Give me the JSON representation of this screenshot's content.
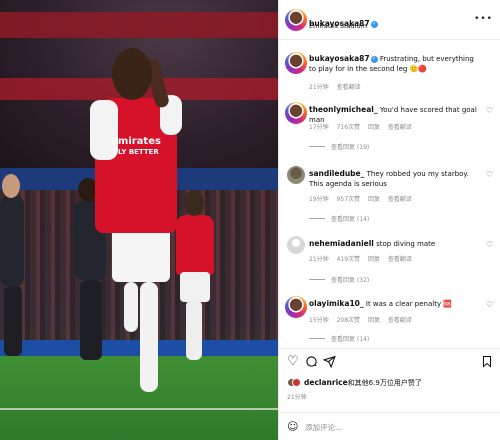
{
  "post": {
    "username": "bukayosaka87",
    "location": "Emirates Stadium",
    "more_icon": "more-horizontal-icon"
  },
  "photo": {
    "shirt_text_line1": "Emirates",
    "shirt_text_line2": "FLY BETTER"
  },
  "caption": {
    "username": "bukayosaka87",
    "text": "Frustrating, but everything to play for in the second leg 🙂🔴",
    "time": "21分钟",
    "translate": "查看翻译"
  },
  "comments": [
    {
      "username": "theonlymicheal_",
      "text": "You'd have scored that goal man",
      "time": "17分钟",
      "likes": "716次赞",
      "reply": "回复",
      "translate": "查看翻译",
      "view_replies": "查看回复 (19)"
    },
    {
      "username": "sandiledube_",
      "text": "They robbed you my starboy. This agenda is serious",
      "time": "19分钟",
      "likes": "957次赞",
      "reply": "回复",
      "translate": "查看翻译",
      "view_replies": "查看回复 (14)"
    },
    {
      "username": "nehemiadaniell",
      "text": "stop diving mate",
      "time": "21分钟",
      "likes": "419次赞",
      "reply": "回复",
      "translate": "查看翻译",
      "view_replies": "查看回复 (32)"
    },
    {
      "username": "olayimika10_",
      "text": "It was a clear penalty 🆘",
      "time": "15分钟",
      "likes": "208次赞",
      "reply": "回复",
      "translate": "查看翻译",
      "view_replies": "查看回复 (14)"
    }
  ],
  "likes_line": {
    "user": "declanrice",
    "rest": "和其他6.9万位用户赞了"
  },
  "post_time": "21分钟",
  "add_comment": {
    "placeholder": "添加评论..."
  },
  "icons": {
    "like": "heart-icon",
    "comment": "comment-icon",
    "share": "share-icon",
    "save": "bookmark-icon",
    "emoji": "smiley-icon"
  },
  "colors": {
    "verified": "#2f9bf0",
    "arsenal_red": "#d5122a"
  }
}
